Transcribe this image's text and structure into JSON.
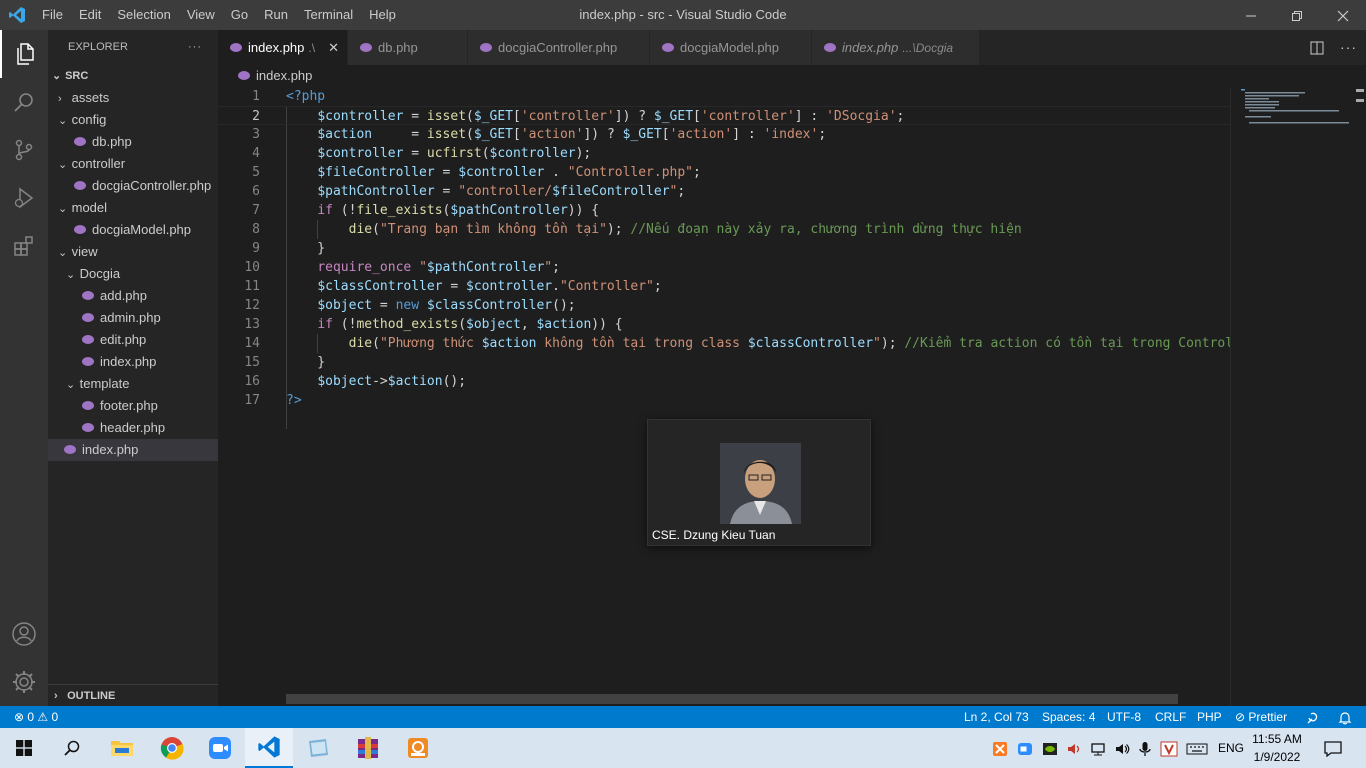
{
  "window": {
    "title": "index.php - src - Visual Studio Code",
    "menu": [
      "File",
      "Edit",
      "Selection",
      "View",
      "Go",
      "Run",
      "Terminal",
      "Help"
    ]
  },
  "explorer": {
    "header": "EXPLORER",
    "more": "···",
    "root": "SRC",
    "items": [
      {
        "label": "assets",
        "type": "folder",
        "open": false,
        "depth": 1
      },
      {
        "label": "config",
        "type": "folder",
        "open": true,
        "depth": 1
      },
      {
        "label": "db.php",
        "type": "file",
        "depth": 2
      },
      {
        "label": "controller",
        "type": "folder",
        "open": true,
        "depth": 1
      },
      {
        "label": "docgiaController.php",
        "type": "file",
        "depth": 2
      },
      {
        "label": "model",
        "type": "folder",
        "open": true,
        "depth": 1
      },
      {
        "label": "docgiaModel.php",
        "type": "file",
        "depth": 2
      },
      {
        "label": "view",
        "type": "folder",
        "open": true,
        "depth": 1
      },
      {
        "label": "Docgia",
        "type": "folder",
        "open": true,
        "depth": 2
      },
      {
        "label": "add.php",
        "type": "file",
        "depth": 3
      },
      {
        "label": "admin.php",
        "type": "file",
        "depth": 3
      },
      {
        "label": "edit.php",
        "type": "file",
        "depth": 3
      },
      {
        "label": "index.php",
        "type": "file",
        "depth": 3
      },
      {
        "label": "template",
        "type": "folder",
        "open": true,
        "depth": 2
      },
      {
        "label": "footer.php",
        "type": "file",
        "depth": 3
      },
      {
        "label": "header.php",
        "type": "file",
        "depth": 3
      },
      {
        "label": "index.php",
        "type": "file",
        "depth": 1,
        "selected": true
      }
    ],
    "outline": "OUTLINE"
  },
  "tabs": [
    {
      "label": "index.php",
      "desc": ".\\",
      "active": true
    },
    {
      "label": "db.php",
      "desc": ""
    },
    {
      "label": "docgiaController.php",
      "desc": ""
    },
    {
      "label": "docgiaModel.php",
      "desc": ""
    },
    {
      "label": "index.php",
      "desc": "...\\Docgia"
    }
  ],
  "breadcrumb": "index.php",
  "editor": {
    "current_line": 2,
    "lines": [
      [
        [
          "b",
          "<"
        ],
        [
          "b",
          "?php"
        ]
      ],
      [
        [
          "o",
          "    "
        ],
        [
          "v",
          "$controller"
        ],
        [
          "o",
          " = "
        ],
        [
          "f",
          "isset"
        ],
        [
          "o",
          "("
        ],
        [
          "v",
          "$_GET"
        ],
        [
          "o",
          "["
        ],
        [
          "s",
          "'controller'"
        ],
        [
          "o",
          "]) ? "
        ],
        [
          "v",
          "$_GET"
        ],
        [
          "o",
          "["
        ],
        [
          "s",
          "'controller'"
        ],
        [
          "o",
          "] : "
        ],
        [
          "s",
          "'DSocgia'"
        ],
        [
          "o",
          ";"
        ]
      ],
      [
        [
          "o",
          "    "
        ],
        [
          "v",
          "$action"
        ],
        [
          "o",
          "     = "
        ],
        [
          "f",
          "isset"
        ],
        [
          "o",
          "("
        ],
        [
          "v",
          "$_GET"
        ],
        [
          "o",
          "["
        ],
        [
          "s",
          "'action'"
        ],
        [
          "o",
          "]) ? "
        ],
        [
          "v",
          "$_GET"
        ],
        [
          "o",
          "["
        ],
        [
          "s",
          "'action'"
        ],
        [
          "o",
          "] : "
        ],
        [
          "s",
          "'index'"
        ],
        [
          "o",
          ";"
        ]
      ],
      [
        [
          "o",
          "    "
        ],
        [
          "v",
          "$controller"
        ],
        [
          "o",
          " = "
        ],
        [
          "f",
          "ucfirst"
        ],
        [
          "o",
          "("
        ],
        [
          "v",
          "$controller"
        ],
        [
          "o",
          ");"
        ]
      ],
      [
        [
          "o",
          "    "
        ],
        [
          "v",
          "$fileController"
        ],
        [
          "o",
          " = "
        ],
        [
          "v",
          "$controller"
        ],
        [
          "o",
          " . "
        ],
        [
          "s",
          "\"Controller.php\""
        ],
        [
          "o",
          ";"
        ]
      ],
      [
        [
          "o",
          "    "
        ],
        [
          "v",
          "$pathController"
        ],
        [
          "o",
          " = "
        ],
        [
          "s",
          "\"controller/"
        ],
        [
          "v",
          "$fileController"
        ],
        [
          "s",
          "\""
        ],
        [
          "o",
          ";"
        ]
      ],
      [
        [
          "o",
          "    "
        ],
        [
          "k",
          "if"
        ],
        [
          "o",
          " (!"
        ],
        [
          "f",
          "file_exists"
        ],
        [
          "o",
          "("
        ],
        [
          "v",
          "$pathController"
        ],
        [
          "o",
          ")) {"
        ]
      ],
      [
        [
          "o",
          "        "
        ],
        [
          "f",
          "die"
        ],
        [
          "o",
          "("
        ],
        [
          "s",
          "\"Trang bạn tìm không tồn tại\""
        ],
        [
          "o",
          "); "
        ],
        [
          "c",
          "//Nếu đoạn này xảy ra, chương trình dừng thực hiện"
        ]
      ],
      [
        [
          "o",
          "    }"
        ]
      ],
      [
        [
          "o",
          "    "
        ],
        [
          "k",
          "require_once"
        ],
        [
          "o",
          " "
        ],
        [
          "s",
          "\""
        ],
        [
          "v",
          "$pathController"
        ],
        [
          "s",
          "\""
        ],
        [
          "o",
          ";"
        ]
      ],
      [
        [
          "o",
          "    "
        ],
        [
          "v",
          "$classController"
        ],
        [
          "o",
          " = "
        ],
        [
          "v",
          "$controller"
        ],
        [
          "o",
          "."
        ],
        [
          "s",
          "\"Controller\""
        ],
        [
          "o",
          ";"
        ]
      ],
      [
        [
          "o",
          "    "
        ],
        [
          "v",
          "$object"
        ],
        [
          "o",
          " = "
        ],
        [
          "b",
          "new"
        ],
        [
          "o",
          " "
        ],
        [
          "v",
          "$classController"
        ],
        [
          "o",
          "();"
        ]
      ],
      [
        [
          "o",
          "    "
        ],
        [
          "k",
          "if"
        ],
        [
          "o",
          " (!"
        ],
        [
          "f",
          "method_exists"
        ],
        [
          "o",
          "("
        ],
        [
          "v",
          "$object"
        ],
        [
          "o",
          ", "
        ],
        [
          "v",
          "$action"
        ],
        [
          "o",
          ")) {"
        ]
      ],
      [
        [
          "o",
          "        "
        ],
        [
          "f",
          "die"
        ],
        [
          "o",
          "("
        ],
        [
          "s",
          "\"Phương thức "
        ],
        [
          "v",
          "$action"
        ],
        [
          "s",
          " không tồn tại trong class "
        ],
        [
          "v",
          "$classController"
        ],
        [
          "s",
          "\""
        ],
        [
          "o",
          "); "
        ],
        [
          "c",
          "//Kiểm tra action có tồn tại trong Controlle"
        ]
      ],
      [
        [
          "o",
          "    }"
        ]
      ],
      [
        [
          "o",
          "    "
        ],
        [
          "v",
          "$object"
        ],
        [
          "o",
          "->"
        ],
        [
          "v",
          "$action"
        ],
        [
          "o",
          "();"
        ]
      ],
      [
        [
          "b",
          "?>"
        ]
      ]
    ]
  },
  "video_card": {
    "name": "CSE. Dzung Kieu Tuan"
  },
  "status": {
    "problems": "⊗ 0 ⚠ 0",
    "position": "Ln 2, Col 73",
    "spaces": "Spaces: 4",
    "encoding": "UTF-8",
    "eol": "CRLF",
    "language": "PHP",
    "formatter": "⊘ Prettier"
  },
  "taskbar": {
    "lang": "ENG",
    "time": "11:55 AM",
    "date": "1/9/2022"
  },
  "colors": {
    "accent": "#007acc",
    "php": "#a074c4"
  }
}
